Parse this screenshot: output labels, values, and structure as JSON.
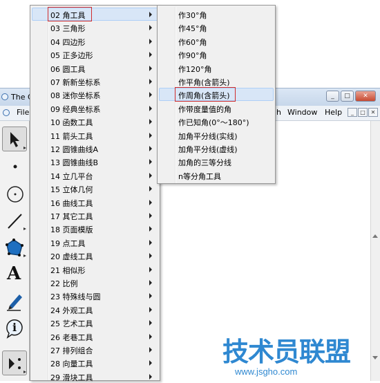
{
  "app": {
    "title": "The C",
    "menubar": {
      "file": "File",
      "h": "h",
      "window": "Window",
      "help": "Help"
    },
    "window_buttons": {
      "minimize": "_",
      "maximize": "□",
      "close": "✕"
    },
    "mdi_buttons": {
      "minimize": "_",
      "maximize": "□",
      "close": "✕"
    }
  },
  "toolbox": {
    "tools": [
      {
        "name": "arrow",
        "selected": true
      },
      {
        "name": "point"
      },
      {
        "name": "compass"
      },
      {
        "name": "straightedge"
      },
      {
        "name": "polygon"
      },
      {
        "name": "text",
        "glyph": "A"
      },
      {
        "name": "marker"
      },
      {
        "name": "information",
        "glyph": "i"
      },
      {
        "name": "custom-tool",
        "selected": true
      }
    ]
  },
  "main_menu": {
    "items": [
      {
        "label": "02 角工具",
        "active": true,
        "highlighted": true
      },
      {
        "label": "03 三角形"
      },
      {
        "label": "04 四边形"
      },
      {
        "label": "05 正多边形"
      },
      {
        "label": "06 圆工具"
      },
      {
        "label": "07 新新坐标系"
      },
      {
        "label": "08 迷你坐标系"
      },
      {
        "label": "09 经典坐标系"
      },
      {
        "label": "10 函数工具"
      },
      {
        "label": "11 箭头工具"
      },
      {
        "label": "12 圆锥曲线A"
      },
      {
        "label": "13 圆锥曲线B"
      },
      {
        "label": "14 立几平台"
      },
      {
        "label": "15 立体几何"
      },
      {
        "label": "16 曲线工具"
      },
      {
        "label": "17 其它工具"
      },
      {
        "label": "18 页面模版"
      },
      {
        "label": "19 点工具"
      },
      {
        "label": "20 虚线工具"
      },
      {
        "label": "21 相似形"
      },
      {
        "label": "22 比例"
      },
      {
        "label": "23 特殊线与圆"
      },
      {
        "label": "24 外观工具"
      },
      {
        "label": "25 艺术工具"
      },
      {
        "label": "26 老巷工具"
      },
      {
        "label": "27 排列组合"
      },
      {
        "label": "28 向量工具"
      },
      {
        "label": "29 滑块工具"
      }
    ]
  },
  "sub_menu": {
    "items": [
      {
        "label": "作30°角"
      },
      {
        "label": "作45°角"
      },
      {
        "label": "作60°角"
      },
      {
        "label": "作90°角"
      },
      {
        "label": "作120°角"
      },
      {
        "label": "作平角(含箭头)"
      },
      {
        "label": "作周角(含箭头)",
        "active": true,
        "highlighted": true
      },
      {
        "label": "作带度量值的角"
      },
      {
        "label": "作已知角(0°～180°)"
      },
      {
        "label": "加角平分线(实线)"
      },
      {
        "label": "加角平分线(虚线)"
      },
      {
        "label": "加角的三等分线"
      },
      {
        "label": "n等分角工具"
      }
    ]
  },
  "watermark": {
    "text": "技术员联盟",
    "url": "www.jsgho.com"
  },
  "colors": {
    "highlight_border": "#d02b2b",
    "menu_hover": "#d8e6f7",
    "watermark": "#2f88d1"
  }
}
